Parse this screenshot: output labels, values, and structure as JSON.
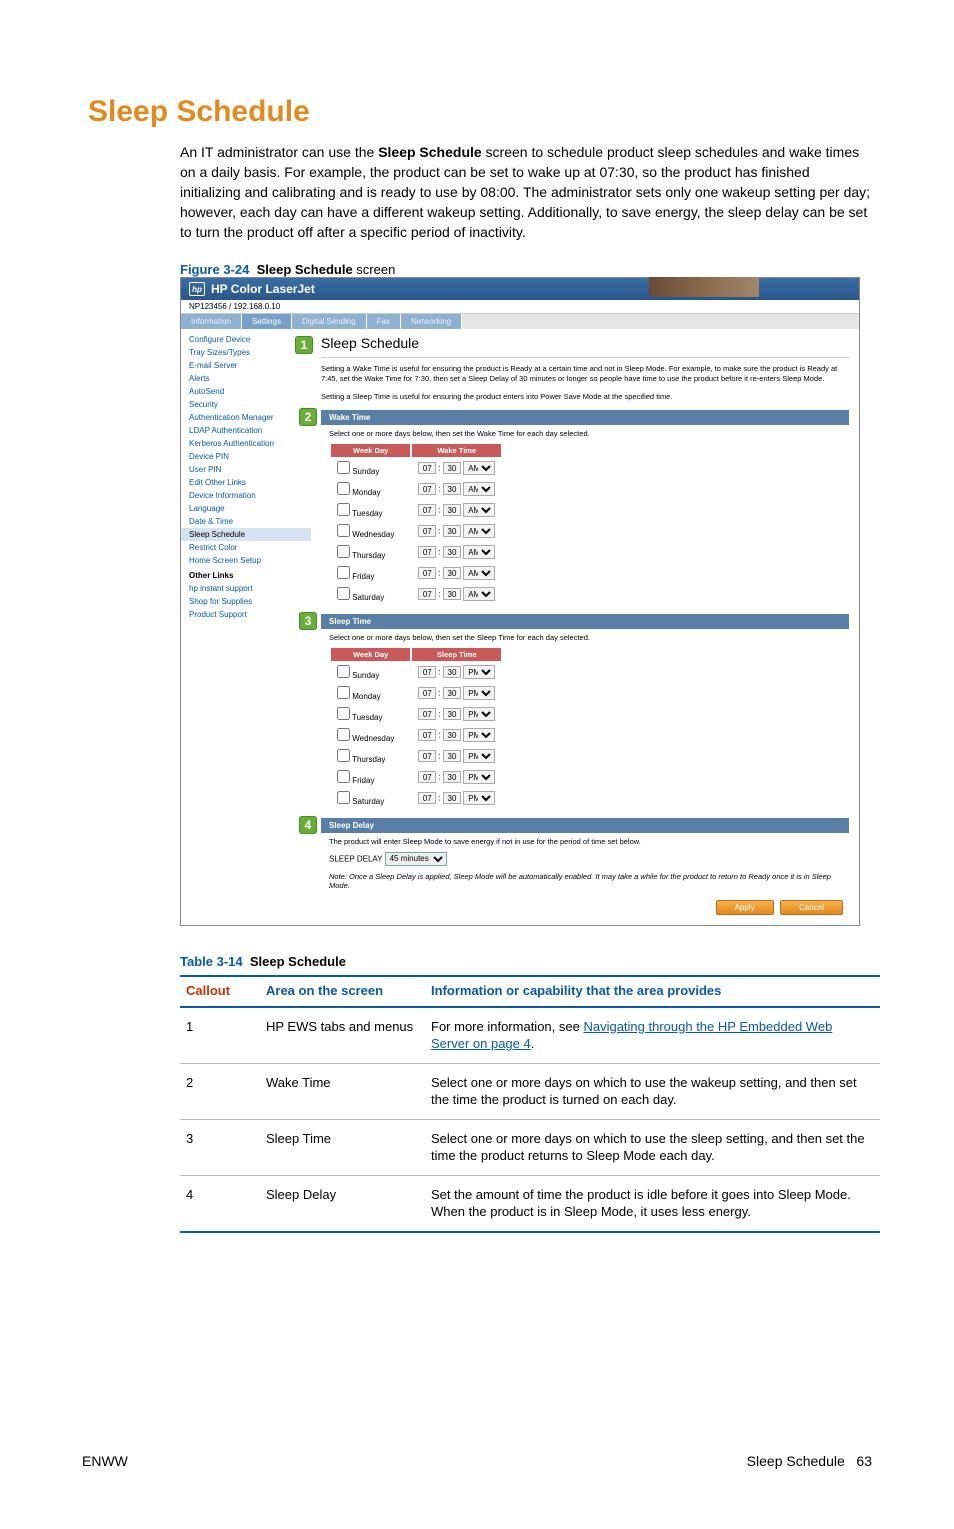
{
  "page": {
    "title": "Sleep Schedule",
    "intro": "An IT administrator can use the Sleep Schedule screen to schedule product sleep schedules and wake times on a daily basis. For example, the product can be set to wake up at 07:30, so the product has finished initializing and calibrating and is ready to use by 08:00. The administrator sets only one wakeup setting per day; however, each day can have a different wakeup setting. Additionally, to save energy, the sleep delay can be set to turn the product off after a specific period of inactivity.",
    "intro_bold_fragment": "Sleep Schedule"
  },
  "figure": {
    "label": "Figure 3-24",
    "title": "Sleep Schedule",
    "suffix": " screen"
  },
  "screenshot": {
    "header_product": "HP Color LaserJet",
    "address": "NP123456 / 192.168.0.10",
    "tabs": [
      "Information",
      "Settings",
      "Digital Sending",
      "Fax",
      "Networking"
    ],
    "active_tab": 1,
    "sidebar": {
      "items": [
        "Configure Device",
        "Tray Sizes/Types",
        "E-mail Server",
        "Alerts",
        "AutoSend",
        "Security",
        "Authentication Manager",
        "LDAP Authentication",
        "Kerberos Authentication",
        "Device PIN",
        "User PIN",
        "Edit Other Links",
        "Device Information",
        "Language",
        "Date & Time",
        "Sleep Schedule",
        "Restrict Color",
        "Home Screen Setup"
      ],
      "active_index": 15,
      "other_header": "Other Links",
      "other_items": [
        "hp instant support",
        "Shop for Supplies",
        "Product Support"
      ]
    },
    "main": {
      "heading": "Sleep Schedule",
      "help1": "Setting a Wake Time is useful for ensuring the product is Ready at a certain time and not in Sleep Mode. For example, to make sure the product is Ready at 7:45, set the Wake Time for 7:30, then set a Sleep Delay of 30 minutes or longer so people have time to use the product before it re-enters Sleep Mode.",
      "help2": "Setting a Sleep Time is useful for ensuring the product enters into Power Save Mode at the specified time.",
      "wake": {
        "panel_title": "Wake Time",
        "note": "Select one or more days below, then set the Wake Time for each day selected.",
        "col1": "Week Day",
        "col2": "Wake Time",
        "days": [
          "Sunday",
          "Monday",
          "Tuesday",
          "Wednesday",
          "Thursday",
          "Friday",
          "Saturday"
        ],
        "hour": "07",
        "minute": "30",
        "ampm": "AM"
      },
      "sleep": {
        "panel_title": "Sleep Time",
        "note": "Select one or more days below, then set the Sleep Time for each day selected.",
        "col1": "Week Day",
        "col2": "Sleep Time",
        "days": [
          "Sunday",
          "Monday",
          "Tuesday",
          "Wednesday",
          "Thursday",
          "Friday",
          "Saturday"
        ],
        "hour": "07",
        "minute": "30",
        "ampm": "PM"
      },
      "delay": {
        "panel_title": "Sleep Delay",
        "text": "The product will enter Sleep Mode to save energy if not in use for the period of time set below.",
        "label": "SLEEP DELAY",
        "value": "45 minutes",
        "note": "Note: Once a Sleep Delay is applied, Sleep Mode will be automatically enabled. It may take a while for the product to return to Ready once it is in Sleep Mode."
      },
      "buttons": {
        "apply": "Apply",
        "cancel": "Cancel"
      }
    }
  },
  "table": {
    "label": "Table 3-14",
    "title": "Sleep Schedule",
    "headers": {
      "callout": "Callout",
      "area": "Area on the screen",
      "info": "Information or capability that the area provides"
    },
    "rows": [
      {
        "callout": "1",
        "area": "HP EWS tabs and menus",
        "info_prefix": "For more information, see ",
        "link_text": "Navigating through the HP Embedded Web Server on page 4",
        "info_suffix": "."
      },
      {
        "callout": "2",
        "area": "Wake Time",
        "info": "Select one or more days on which to use the wakeup setting, and then set the time the product is turned on each day."
      },
      {
        "callout": "3",
        "area": "Sleep Time",
        "info": "Select one or more days on which to use the sleep setting, and then set the time the product returns to Sleep Mode each day."
      },
      {
        "callout": "4",
        "area": "Sleep Delay",
        "info": "Set the amount of time the product is idle before it goes into Sleep Mode. When the product is in Sleep Mode, it uses less energy."
      }
    ]
  },
  "footer": {
    "left": "ENWW",
    "right_text": "Sleep Schedule",
    "page_num": "63"
  }
}
